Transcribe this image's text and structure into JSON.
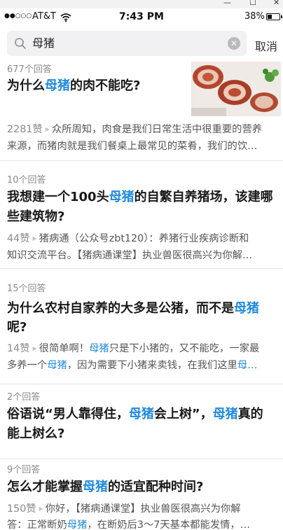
{
  "window": {
    "minimize": "—",
    "maximize": "☐",
    "close": "✕"
  },
  "status_bar": {
    "signal": "●●○○○",
    "carrier": "AT&T",
    "time": "7:43 PM",
    "battery_percent": "38%",
    "battery_level": 0.38
  },
  "search": {
    "query": "母猪",
    "placeholder": "",
    "cancel_label": "取消"
  },
  "colors": {
    "accent": "#1e8ae0",
    "divider": "#e6e6e6",
    "muted": "#8a8a8a"
  },
  "results": [
    {
      "answers": "677个回答",
      "title_parts": [
        "为什么",
        "母猪",
        "的肉不能吃?"
      ],
      "likes": "2281赞",
      "excerpt_line1": "众所周知，肉食是我们日常生活中很重要的营养",
      "excerpt_line2": "来源，而猪肉就是我们餐桌上最常见的菜肴，我们的饮…",
      "image": "bacon-thumbnail"
    },
    {
      "answers": "10个回答",
      "title_line1_parts": [
        "我想建一个100头",
        "母猪",
        "的自繁自养猪场，该建哪"
      ],
      "title_line2": "些建筑物?",
      "likes": "44赞",
      "excerpt_line1": "猪病通（公众号zbt120）：养猪行业疾病诊断和",
      "excerpt_line2": "知识交流平台。【猪病通课堂】执业兽医很高兴为你解…"
    },
    {
      "answers": "15个回答",
      "title_line1_parts": [
        "为什么农村自家养的大多是公猪，而不是",
        "母猪"
      ],
      "title_line2": "呢?",
      "likes": "14赞",
      "excerpt_line1_parts": [
        "很简单啊！",
        "母猪",
        "只是下小猪的，又不能吃，一家最"
      ],
      "excerpt_line2_parts": [
        "多养一个",
        "母猪",
        "，因为需要下小猪来卖钱，在我们这里",
        "母…"
      ]
    },
    {
      "answers": "2个回答",
      "title_line1_parts": [
        "俗语说“男人靠得住，",
        "母猪",
        "会上树”，",
        "母猪",
        "真的"
      ],
      "title_line2": "能上树么?"
    },
    {
      "answers": "9个回答",
      "title_parts": [
        "怎么才能掌握",
        "母猪",
        "的适宜配种时间?"
      ],
      "likes": "150赞",
      "excerpt_line1": "你好，【猪病通课堂】执业兽医很高兴为你解",
      "excerpt_line2_parts": [
        "答：正常断奶",
        "母猪",
        "，在断奶后3～7天基本都能发情，…"
      ]
    }
  ]
}
